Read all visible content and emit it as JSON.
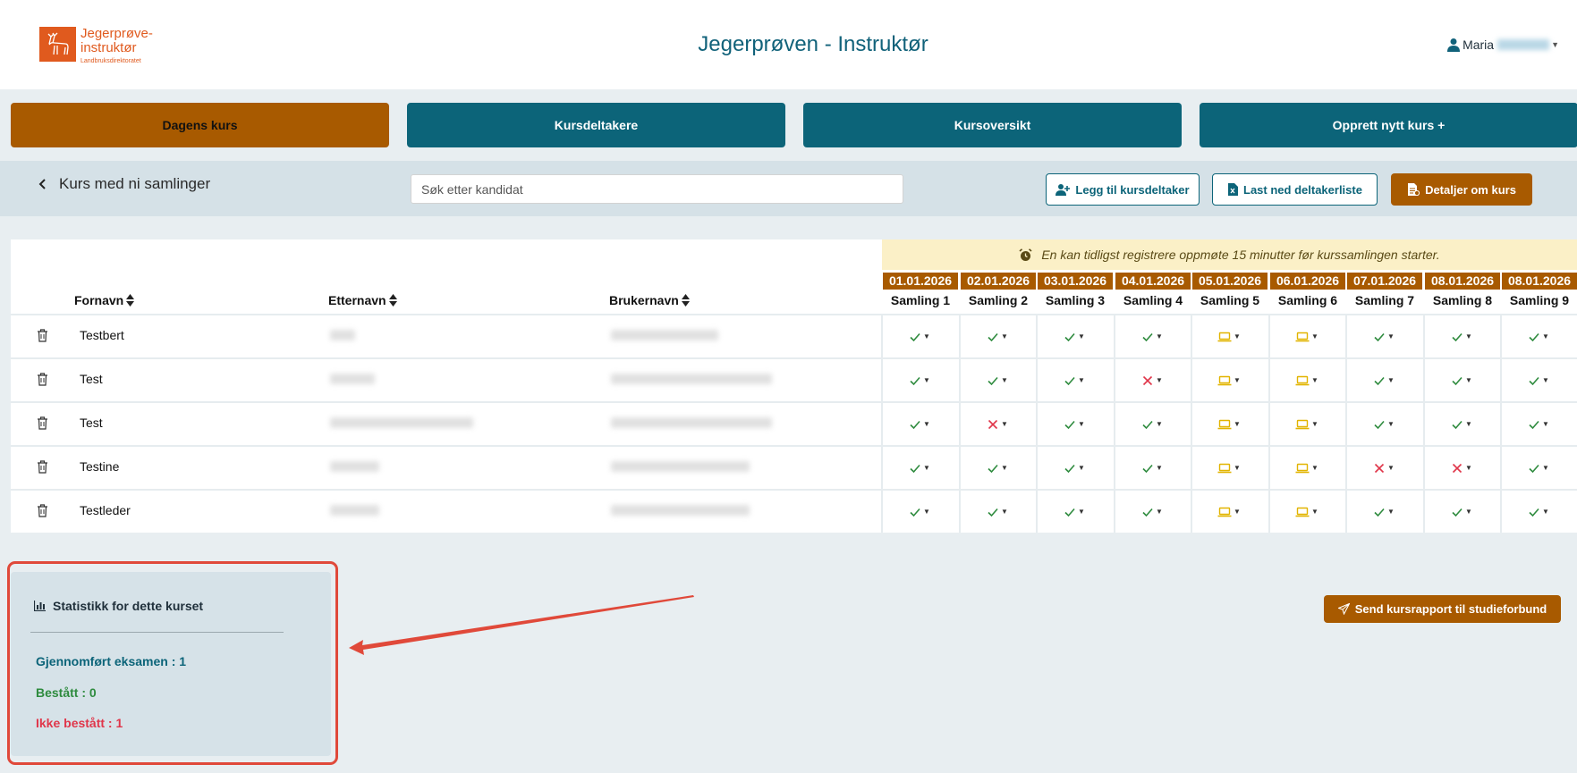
{
  "header": {
    "logo_line1": "Jegerprøve-",
    "logo_line2": "instruktør",
    "logo_sub": "Landbruksdirektoratet",
    "title": "Jegerprøven - Instruktør",
    "user_name": "Maria"
  },
  "nav": [
    {
      "label": "Dagens kurs"
    },
    {
      "label": "Kursdeltakere"
    },
    {
      "label": "Kursoversikt"
    },
    {
      "label": "Opprett nytt kurs +"
    }
  ],
  "toolbar": {
    "course_title": "Kurs med ni samlinger",
    "search_placeholder": "Søk etter kandidat",
    "add_participant": "Legg til kursdeltaker",
    "download_list": "Last ned deltakerliste",
    "course_details": "Detaljer om kurs"
  },
  "table": {
    "notice": "En kan tidligst registrere oppmøte 15 minutter før kurssamlingen starter.",
    "col_firstname": "Fornavn",
    "col_lastname": "Etternavn",
    "col_username": "Brukernavn",
    "sessions": [
      {
        "date": "01.01.2026",
        "name": "Samling 1"
      },
      {
        "date": "02.01.2026",
        "name": "Samling 2"
      },
      {
        "date": "03.01.2026",
        "name": "Samling 3"
      },
      {
        "date": "04.01.2026",
        "name": "Samling 4"
      },
      {
        "date": "05.01.2026",
        "name": "Samling 5"
      },
      {
        "date": "06.01.2026",
        "name": "Samling 6"
      },
      {
        "date": "07.01.2026",
        "name": "Samling 7"
      },
      {
        "date": "08.01.2026",
        "name": "Samling 8"
      },
      {
        "date": "08.01.2026",
        "name": "Samling 9"
      }
    ],
    "rows": [
      {
        "firstname": "Testbert",
        "attendance": [
          "present",
          "present",
          "present",
          "present",
          "digital",
          "digital",
          "present",
          "present",
          "present"
        ]
      },
      {
        "firstname": "Test",
        "attendance": [
          "present",
          "present",
          "present",
          "absent",
          "digital",
          "digital",
          "present",
          "present",
          "present"
        ]
      },
      {
        "firstname": "Test",
        "attendance": [
          "present",
          "absent",
          "present",
          "present",
          "digital",
          "digital",
          "present",
          "present",
          "present"
        ]
      },
      {
        "firstname": "Testine",
        "attendance": [
          "present",
          "present",
          "present",
          "present",
          "digital",
          "digital",
          "absent",
          "absent",
          "present"
        ]
      },
      {
        "firstname": "Testleder",
        "attendance": [
          "present",
          "present",
          "present",
          "present",
          "digital",
          "digital",
          "present",
          "present",
          "present"
        ]
      }
    ]
  },
  "stats": {
    "title": "Statistikk for dette kurset",
    "completed_exam": "Gjennomført eksamen : 1",
    "passed": "Bestått : 0",
    "failed": "Ikke bestått : 1"
  },
  "send_report": "Send kursrapport til studieforbund",
  "colors": {
    "primary": "#0c6479",
    "accent": "#a85a00",
    "present": "#2e8b3e",
    "absent": "#e0364a",
    "digital": "#e2b400",
    "annotation": "#e0493a"
  }
}
